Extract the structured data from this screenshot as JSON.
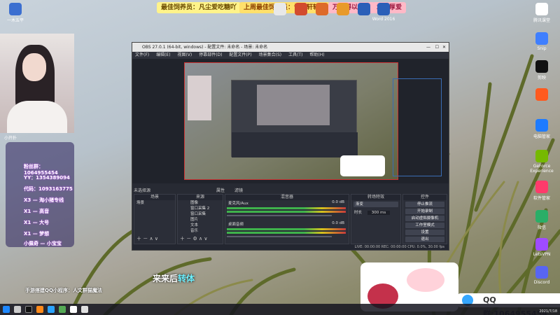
{
  "banners": [
    {
      "text": "最佳饲养员：凡尘爱吃糖吖",
      "bg": "#fff38a",
      "fg": "#6a4b00"
    },
    {
      "text": "上周最佳饲养员：许轩轩轩轩",
      "bg": "#ffe06b",
      "fg": "#8a3f00"
    },
    {
      "text": "万事得以相识",
      "bg": "#ffb9c7",
      "fg": "#9b1a40"
    },
    {
      "text": "承蒙厚爱",
      "bg": "#ffb9c7",
      "fg": "#9b1a40"
    }
  ],
  "top_icons": [
    "",
    "",
    "",
    "",
    "",
    "Word 2016"
  ],
  "left_desktop": {
    "top_label": "一木五平",
    "webcam_label": "小开扑"
  },
  "info_panel": {
    "rows": [
      "粉丝群：1064955454",
      "YY：1354389094",
      "代码：1093163775",
      "X3 — 淘小猪专线",
      "X1 — 高音",
      "X1 — 大号",
      "X1 — 梦想",
      "小佩奇 — 小宝宝"
    ]
  },
  "obs": {
    "title": "OBS 27.0.1 (64-bit, windows) - 配置文件: 未命名 - 场景: 未命名",
    "menu": [
      "文件(F)",
      "编辑(E)",
      "视图(V)",
      "停靠部件(D)",
      "配置文件(P)",
      "场景集合(S)",
      "工具(T)",
      "帮助(H)"
    ],
    "filter_label": "未选择源",
    "props_label": "属性",
    "filters_label": "滤镜",
    "scenes_header": "场景",
    "scenes": [
      "场景"
    ],
    "sources_header": "来源",
    "sources": [
      "图像",
      "窗口采集 2",
      "窗口采集",
      "图片",
      "文本",
      "音乐"
    ],
    "mixer_header": "混音器",
    "mixer": [
      {
        "name": "麦克风/Aux",
        "db": "0.0 dB"
      },
      {
        "name": "桌面音频",
        "db": "0.0 dB"
      }
    ],
    "transitions_header": "转场特效",
    "transition_type": "渐变",
    "duration_label": "时长",
    "duration_value": "300 ms",
    "controls_header": "控件",
    "controls": [
      "停止推流",
      "开始录制",
      "启动虚拟摄像机",
      "工作室模式",
      "设置",
      "退出"
    ],
    "status": "LIVE: 00:00:00   REC: 00:00:00   CPU: 0.0%, 30.00 fps"
  },
  "dock_icons": [
    {
      "label": "腾讯课堂",
      "color": "#ffffff"
    },
    {
      "label": "Snip",
      "color": "#3f7fff"
    },
    {
      "label": "剪映",
      "color": "#111111"
    },
    {
      "label": "",
      "color": "#ff5a1f"
    },
    {
      "label": "电脑管家",
      "color": "#1e7bff"
    },
    {
      "label": "GeForce Experience",
      "color": "#76b900"
    },
    {
      "label": "软件管家",
      "color": "#ff3a6b"
    },
    {
      "label": "微信",
      "color": "#2aae67"
    },
    {
      "label": "LetsVPN",
      "color": "#9f4bff"
    },
    {
      "label": "Discord",
      "color": "#5865f2"
    }
  ],
  "caption": {
    "prefix": "来来后",
    "highlight": "转体"
  },
  "scroll_text": "手游搭建QQ小程序：人文群猫魔法",
  "qq_group": "QQ群:1064955454",
  "clock": "2021/7/18"
}
